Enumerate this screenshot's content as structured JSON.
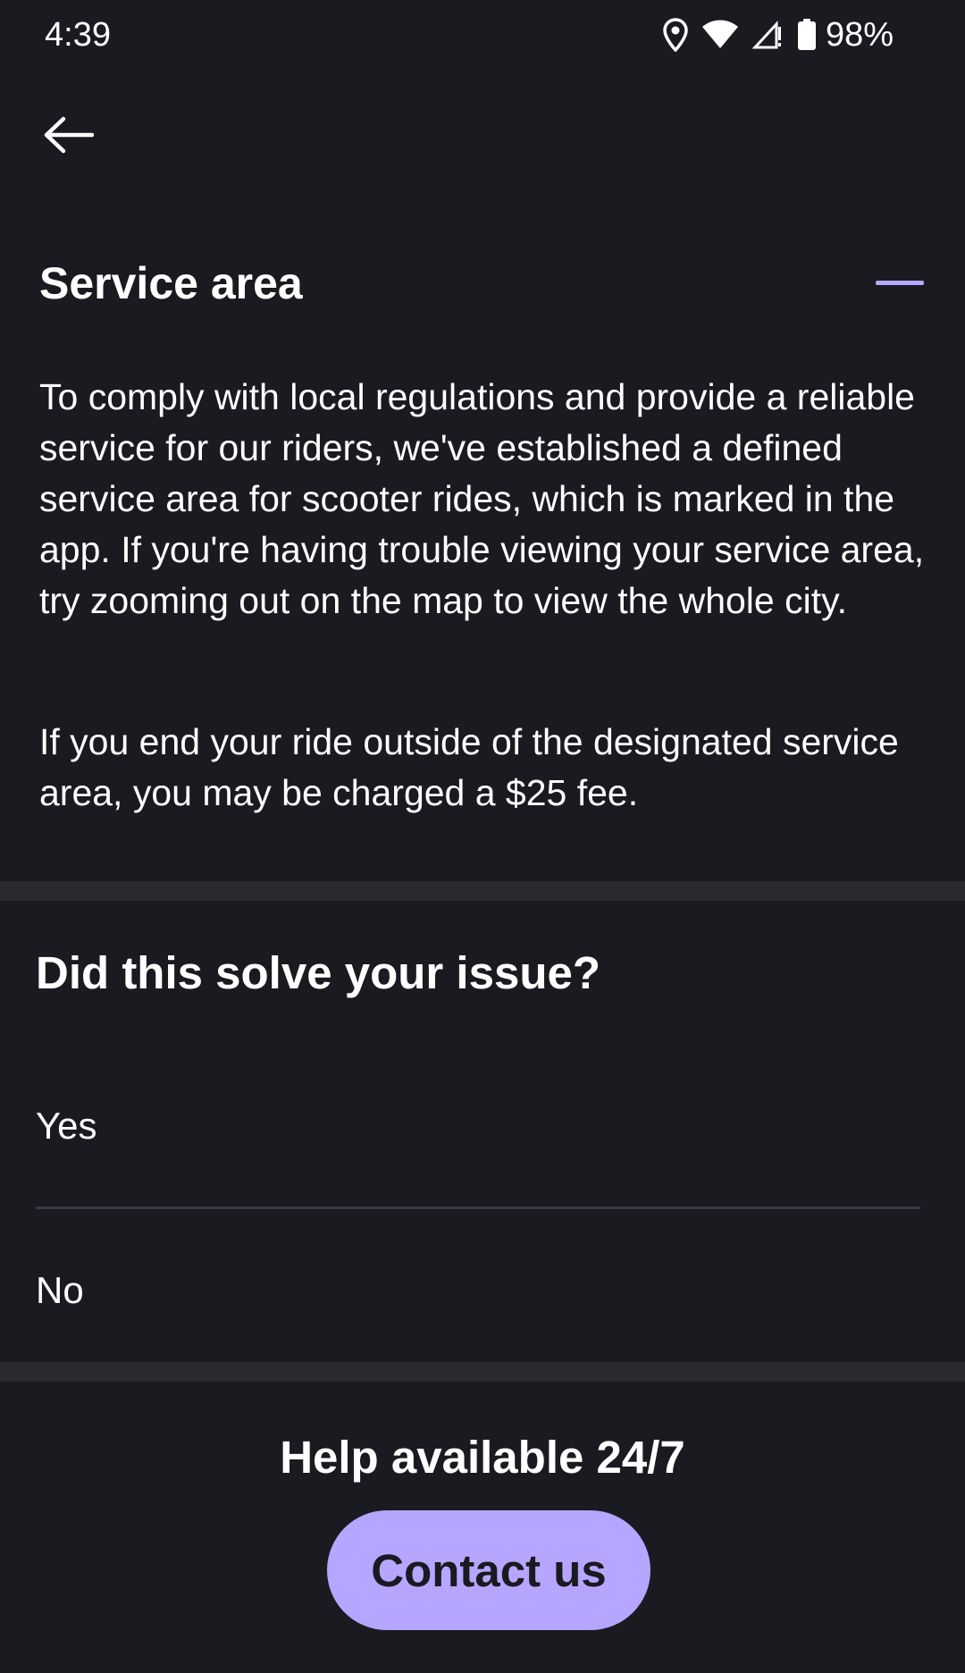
{
  "status_bar": {
    "time": "4:39",
    "battery_percent": "98%",
    "icons": [
      "location-icon",
      "wifi-icon",
      "signal-icon",
      "battery-icon"
    ]
  },
  "nav": {
    "back_icon": "arrow-left-icon"
  },
  "section": {
    "title": "Service area",
    "collapse_icon": "minus-icon",
    "paragraphs": [
      "To comply with local regulations and provide a reliable service for our riders, we've established a defined service area for scooter rides, which is marked in the app. If you're having trouble viewing your service area, try zooming out on the map to view the whole city.",
      "If you end your ride outside of the designated service area, you may be charged a $25 fee."
    ]
  },
  "feedback": {
    "question": "Did this solve your issue?",
    "options": [
      "Yes",
      "No"
    ]
  },
  "help": {
    "title": "Help available 24/7",
    "contact_label": "Contact us"
  },
  "colors": {
    "background": "#1a1a21",
    "accent": "#b6a6ff",
    "divider_band": "#2a2a30",
    "text": "#ffffff"
  }
}
